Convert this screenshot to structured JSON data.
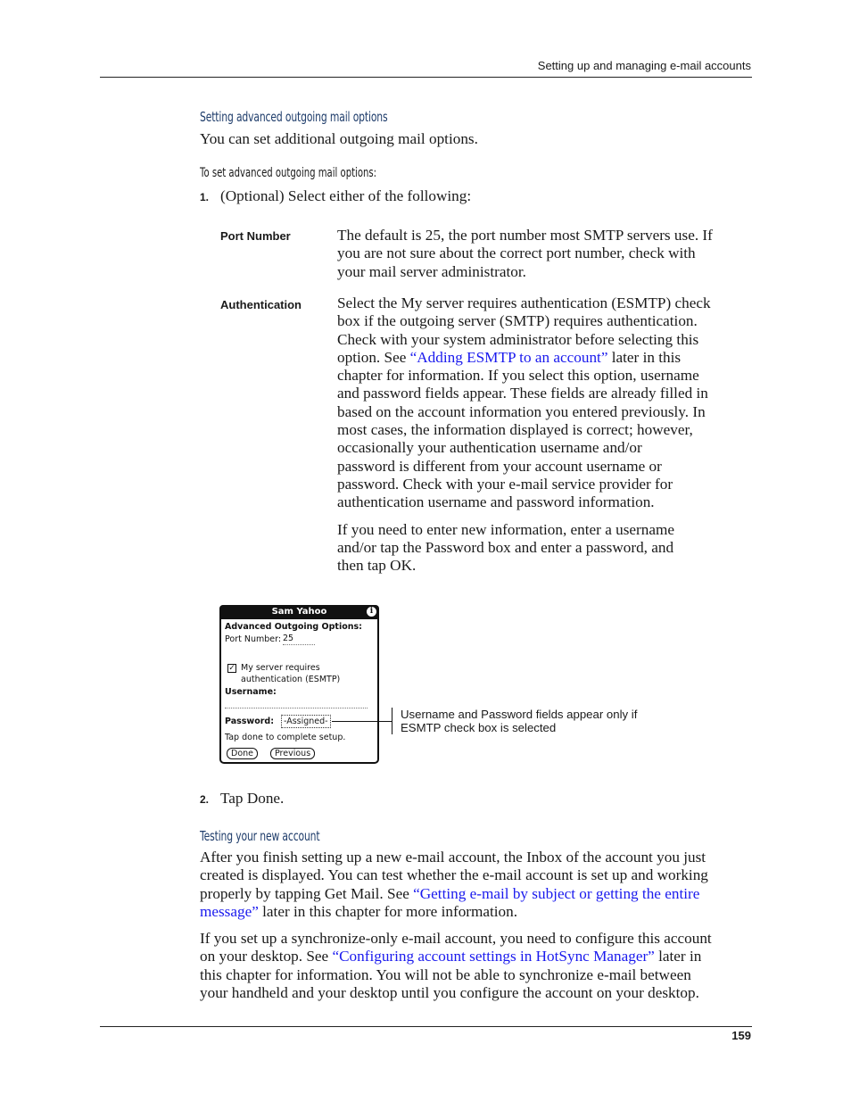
{
  "header": {
    "running_head": "Setting up and managing e-mail accounts"
  },
  "section1": {
    "heading": "Setting advanced outgoing mail options",
    "intro": "You can set additional outgoing mail options.",
    "procedure_heading": "To set advanced outgoing mail options:",
    "step1": {
      "number": "1.",
      "text": "(Optional) Select either of the following:"
    },
    "options": [
      {
        "term": "Port Number",
        "lines": [
          "The default is 25, the port number most SMTP servers use. If",
          "you are not sure about the correct port number, check with",
          "your mail server administrator."
        ]
      },
      {
        "term": "Authentication",
        "line1": "Select the My server requires authentication (ESMTP) check",
        "line2": "box if the outgoing server (SMTP) requires authentication.",
        "line3": "Check with your system administrator before selecting this",
        "line4_pre": "option. See ",
        "line4_link": "“Adding ESMTP to an account”",
        "line4_post": " later in this",
        "rest_lines": [
          "chapter for information. If you select this option, username",
          "and password fields appear. These fields are already filled in",
          "based on the account information you entered previously. In",
          "most cases, the information displayed is correct; however,",
          "occasionally your authentication username and/or",
          "password is different from your account username or",
          "password. Check with your e-mail service provider for",
          "authentication username and password information."
        ],
        "para2_lines": [
          "If you need to enter new information, enter a username",
          "and/or tap the Password box and enter a password, and",
          "then tap OK."
        ]
      }
    ],
    "step2": {
      "number": "2.",
      "text": "Tap Done."
    }
  },
  "device_screen": {
    "title": "Sam Yahoo",
    "info_icon": "i",
    "form_heading": "Advanced Outgoing Options:",
    "port_label": "Port Number:",
    "port_value": "25",
    "checkbox_checked": true,
    "checkbox_glyph": "☑",
    "checkbox_label_line1": "My server requires",
    "checkbox_label_line2": "authentication (ESMTP)",
    "username_label": "Username:",
    "username_value": "",
    "password_label": "Password:",
    "password_value": "-Assigned-",
    "hint": "Tap done to complete setup.",
    "done_button": "Done",
    "previous_button": "Previous"
  },
  "callout": {
    "line1": "Username and Password fields appear only if",
    "line2": "ESMTP check box is selected"
  },
  "section2": {
    "heading": "Testing your new account",
    "para1": {
      "line1": "After you finish setting up a new e-mail account, the Inbox of the account you just",
      "line2": "created is displayed. You can test whether the e-mail account is set up and working",
      "line3_pre": "properly by tapping Get Mail. See ",
      "line3_link": "“Getting e-mail by subject or getting the entire",
      "line4_link": "message”",
      "line4_post": " later in this chapter for more information."
    },
    "para2": {
      "line1": "If you set up a synchronize-only e-mail account, you need to configure this account",
      "line2_pre": "on your desktop. See ",
      "line2_link": "“Configuring account settings in HotSync Manager”",
      "line2_post": " later in",
      "line3": "this chapter for information. You will not be able to synchronize e-mail between",
      "line4": "your handheld and your desktop until you configure the account on your desktop."
    }
  },
  "footer": {
    "page_number": "159"
  },
  "colors": {
    "heading": "#1f3d6b",
    "link": "#1a1aee",
    "text": "#1a1a1a"
  }
}
